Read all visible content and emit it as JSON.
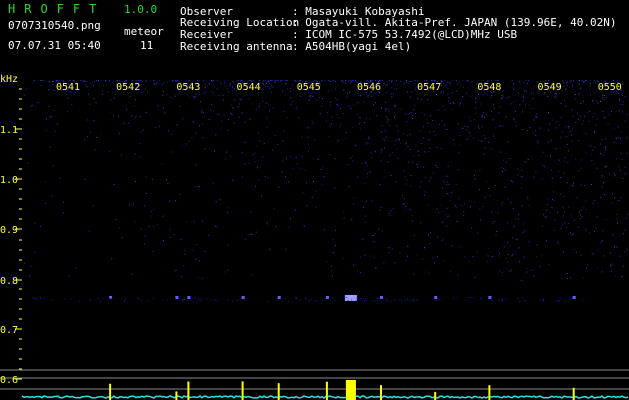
{
  "app": {
    "title": "HROFFT",
    "version": "1.0.0",
    "filename": "0707310540.png",
    "datetime": "07.07.31 05:40",
    "meteor_label": "meteor",
    "meteor_count": "11"
  },
  "info": [
    {
      "label": "Observer",
      "value": ": Masayuki Kobayashi"
    },
    {
      "label": "Receiving Location",
      "value": ": Ogata-vill. Akita-Pref. JAPAN (139.96E, 40.02N)"
    },
    {
      "label": "Receiver",
      "value": ": ICOM IC-575 53.7492(@LCD)MHz USB"
    },
    {
      "label": "Receiving antenna",
      "value": ": A504HB(yagi 4el)"
    }
  ],
  "axis": {
    "y_unit": "kHz",
    "y_ticks": [
      "1.1",
      "1.0",
      "0.9",
      "0.8",
      "0.7",
      "0.6"
    ],
    "x_ticks": [
      "0541",
      "0542",
      "0543",
      "0544",
      "0545",
      "0546",
      "0547",
      "0548",
      "0549",
      "0550"
    ]
  },
  "colors": {
    "label_green": "#2ed52e",
    "text_white": "#ffffff",
    "tick_yellow": "#ffff40",
    "noise_blue": "#2020d0",
    "trace_cyan": "#30e0e0",
    "echo_yellow": "#ffff00"
  },
  "meteor_echo_times": [
    "0541.7",
    "0542.8",
    "0543.0",
    "0543.9",
    "0544.5",
    "0545.3",
    "0545.7",
    "0546.2",
    "0547.1",
    "0548.0",
    "0549.4"
  ]
}
